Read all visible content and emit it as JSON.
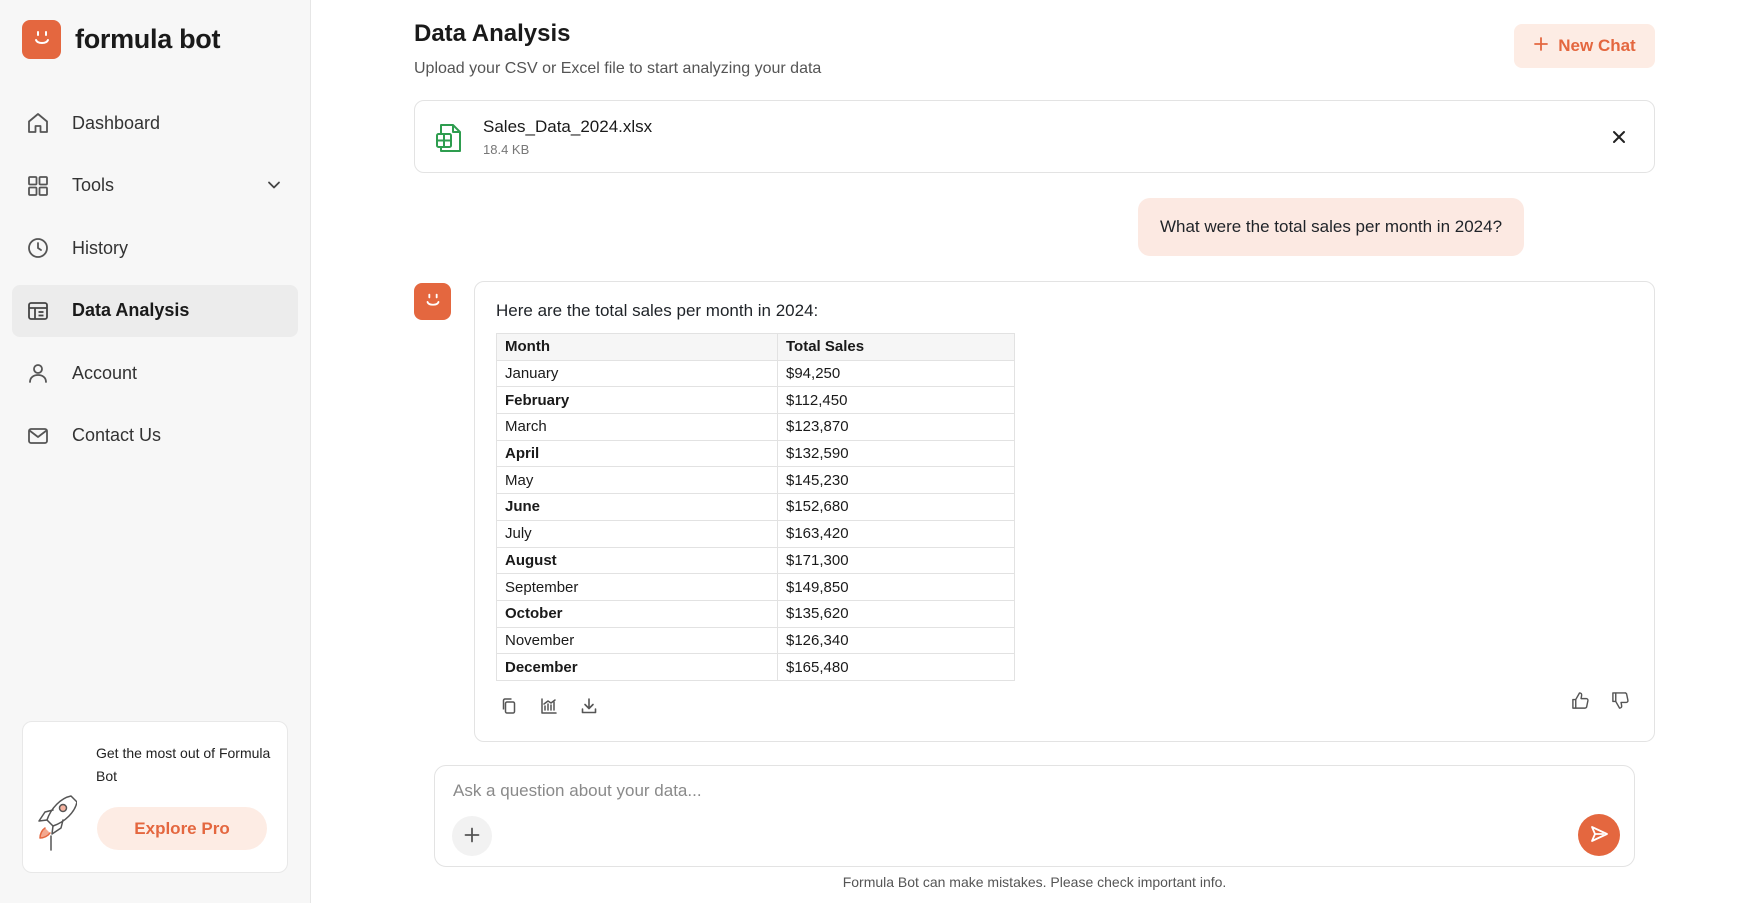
{
  "brand": {
    "name": "formula bot",
    "color": "#e4673f"
  },
  "sidebar": {
    "items": [
      {
        "label": "Dashboard",
        "icon": "home-icon"
      },
      {
        "label": "Tools",
        "icon": "grid-icon"
      },
      {
        "label": "History",
        "icon": "clock-icon"
      },
      {
        "label": "Data Analysis",
        "icon": "table-icon",
        "active": true
      },
      {
        "label": "Account",
        "icon": "user-icon"
      },
      {
        "label": "Contact Us",
        "icon": "mail-icon"
      }
    ],
    "promo": {
      "text": "Get the most out of Formula Bot",
      "button": "Explore Pro",
      "icon": "rocket-icon"
    }
  },
  "header": {
    "title": "Data Analysis",
    "subtitle": "Upload your CSV or Excel file to start analyzing your data",
    "new_chat": "New Chat"
  },
  "file": {
    "name": "Sales_Data_2024.xlsx",
    "size": "18.4 KB",
    "icon": "spreadsheet-icon"
  },
  "chat": {
    "user_message": "What were the total sales per month in 2024?",
    "bot_intro": "Here are the total sales per month in 2024:",
    "table": {
      "headers": [
        "Month",
        "Total Sales"
      ],
      "rows": [
        [
          "January",
          "$94,250"
        ],
        [
          "February",
          "$112,450"
        ],
        [
          "March",
          "$123,870"
        ],
        [
          "April",
          "$132,590"
        ],
        [
          "May",
          "$145,230"
        ],
        [
          "June",
          "$152,680"
        ],
        [
          "July",
          "$163,420"
        ],
        [
          "August",
          "$171,300"
        ],
        [
          "September",
          "$149,850"
        ],
        [
          "October",
          "$135,620"
        ],
        [
          "November",
          "$126,340"
        ],
        [
          "December",
          "$165,480"
        ]
      ]
    }
  },
  "composer": {
    "placeholder": "Ask a question about your data..."
  },
  "footer": {
    "disclaimer": "Formula Bot can make mistakes. Please check important info."
  }
}
